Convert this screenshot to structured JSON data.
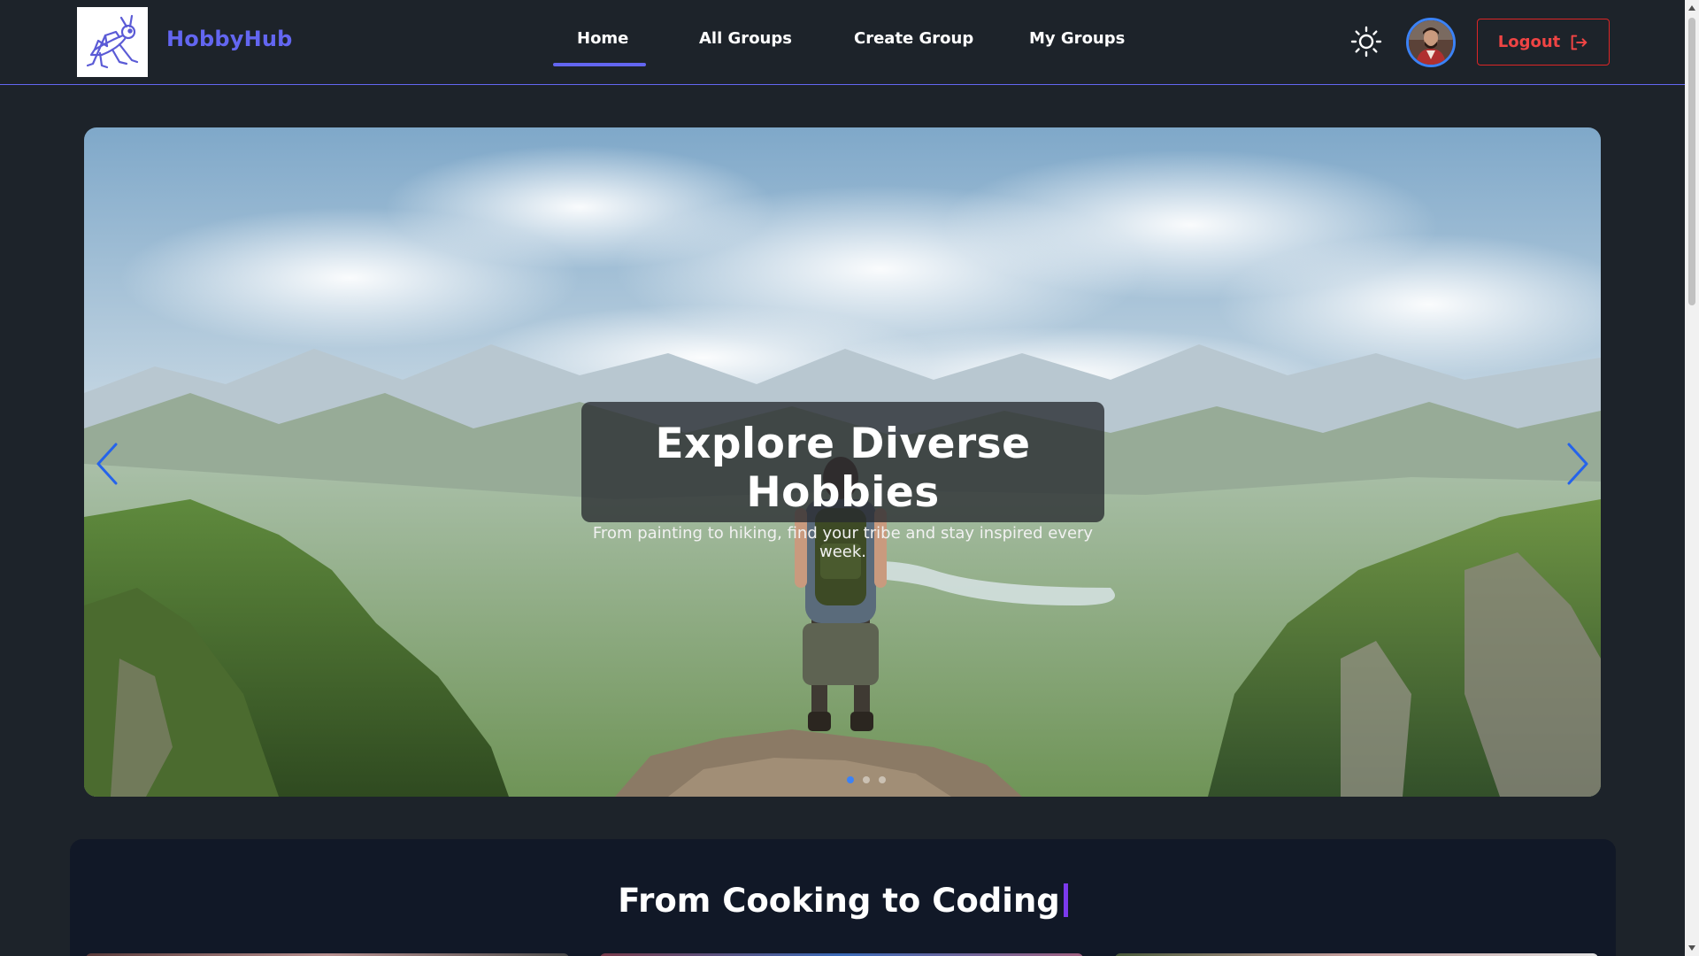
{
  "brand": {
    "name": "HobbyHub",
    "logo_icon": "grasshopper-logo-icon"
  },
  "nav": {
    "items": [
      {
        "label": "Home",
        "active": true
      },
      {
        "label": "All Groups",
        "active": false
      },
      {
        "label": "Create Group",
        "active": false
      },
      {
        "label": "My Groups",
        "active": false
      }
    ]
  },
  "header_actions": {
    "theme_icon": "sun-icon",
    "avatar_icon": "user-avatar",
    "logout_label": "Logout",
    "logout_icon": "logout-icon"
  },
  "hero": {
    "title": "Explore Diverse Hobbies",
    "subtitle": "From painting to hiking, find your tribe and stay inspired every week.",
    "prev_icon": "chevron-left-icon",
    "next_icon": "chevron-right-icon",
    "slide_count": 3,
    "active_slide": 1
  },
  "section": {
    "title": "From Cooking to Coding"
  },
  "colors": {
    "background": "#1d232a",
    "accent": "#6366f1",
    "danger": "#ef4444",
    "section_bg": "#111827",
    "typing_cursor": "#7c3aed"
  }
}
